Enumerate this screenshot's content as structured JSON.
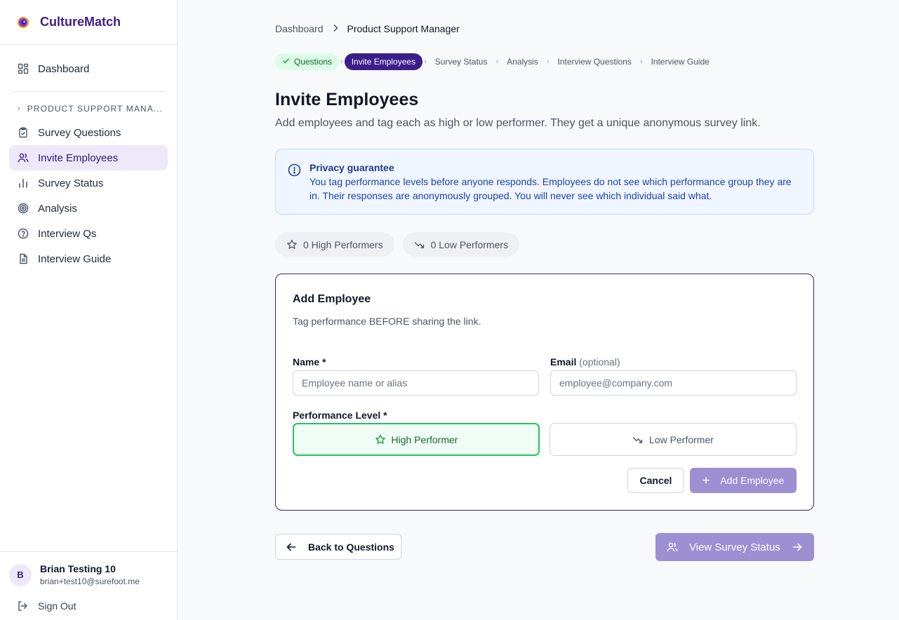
{
  "brand": {
    "name": "CultureMatch"
  },
  "sidebar": {
    "dashboard": "Dashboard",
    "section_title": "PRODUCT SUPPORT MANA...",
    "items": [
      {
        "label": "Survey Questions",
        "icon": "clipboard-icon"
      },
      {
        "label": "Invite Employees",
        "icon": "users-icon",
        "active": true
      },
      {
        "label": "Survey Status",
        "icon": "bar-chart-icon"
      },
      {
        "label": "Analysis",
        "icon": "target-icon"
      },
      {
        "label": "Interview Qs",
        "icon": "help-circle-icon"
      },
      {
        "label": "Interview Guide",
        "icon": "document-icon"
      }
    ],
    "user": {
      "initial": "B",
      "name": "Brian Testing 10",
      "email": "brian+test10@surefoot.me"
    },
    "sign_out": "Sign Out"
  },
  "breadcrumb": {
    "root": "Dashboard",
    "current": "Product Support Manager"
  },
  "steps": [
    {
      "label": "Questions",
      "state": "done"
    },
    {
      "label": "Invite Employees",
      "state": "current"
    },
    {
      "label": "Survey Status",
      "state": "pending"
    },
    {
      "label": "Analysis",
      "state": "pending"
    },
    {
      "label": "Interview Questions",
      "state": "pending"
    },
    {
      "label": "Interview Guide",
      "state": "pending"
    }
  ],
  "page": {
    "title": "Invite Employees",
    "subtitle": "Add employees and tag each as high or low performer. They get a unique anonymous survey link."
  },
  "privacy": {
    "title": "Privacy guarantee",
    "text": "You tag performance levels before anyone responds. Employees do not see which performance group they are in. Their responses are anonymously grouped. You will never see which individual said what."
  },
  "counts": {
    "high": "0 High Performers",
    "low": "0 Low Performers"
  },
  "form": {
    "title": "Add Employee",
    "subtitle": "Tag performance BEFORE sharing the link.",
    "name_label": "Name *",
    "name_placeholder": "Employee name or alias",
    "email_label": "Email",
    "email_optional": "(optional)",
    "email_placeholder": "employee@company.com",
    "perf_label": "Performance Level *",
    "high_label": "High Performer",
    "low_label": "Low Performer",
    "cancel": "Cancel",
    "add": "Add Employee"
  },
  "footer": {
    "back": "Back to Questions",
    "next": "View Survey Status"
  },
  "colors": {
    "brand": "#3b1e8a",
    "active_bg": "#ede9fa",
    "success": "#22c55e",
    "disabled_primary": "#9c8fd2",
    "info_bg": "#eff6ff"
  }
}
